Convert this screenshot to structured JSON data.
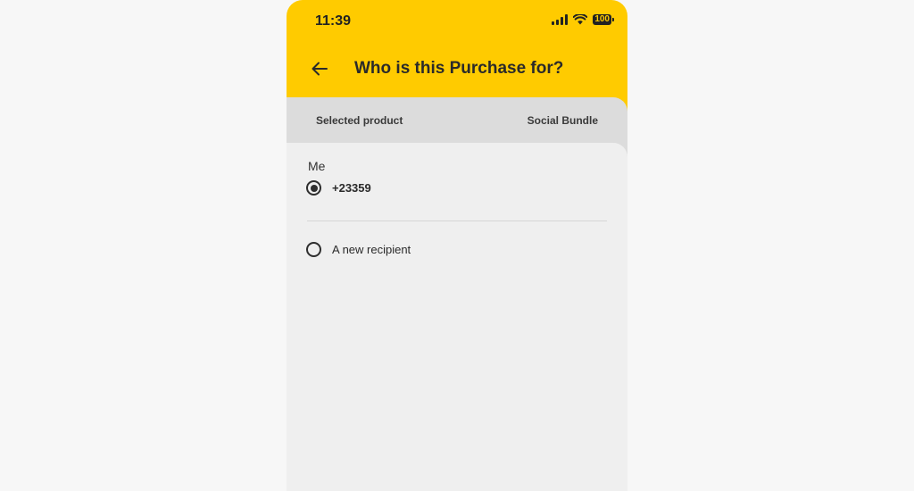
{
  "status_bar": {
    "time": "11:39",
    "battery": "100",
    "icons": [
      "signal-icon",
      "wifi-icon",
      "battery-icon"
    ]
  },
  "header": {
    "title": "Who is this Purchase for?",
    "back_icon": "arrow-left-icon",
    "background_color": "#ffcb00"
  },
  "product": {
    "label": "Selected product",
    "value": "Social Bundle"
  },
  "recipients": {
    "section_title": "Me",
    "options": [
      {
        "label": "+23359",
        "selected": true
      },
      {
        "label": "A new recipient",
        "selected": false
      }
    ]
  }
}
